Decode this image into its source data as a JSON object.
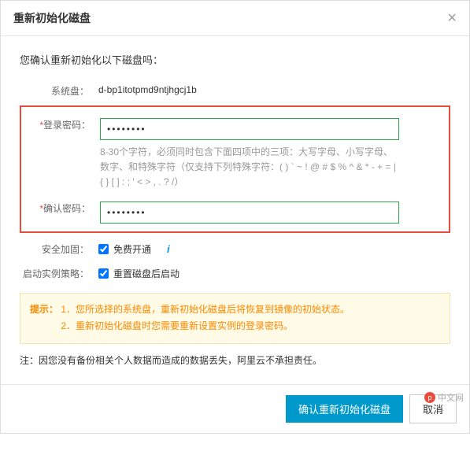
{
  "header": {
    "title": "重新初始化磁盘"
  },
  "body": {
    "confirm_question": "您确认重新初始化以下磁盘吗：",
    "system_disk_label": "系统盘：",
    "system_disk_value": "d-bp1itotpmd9ntjhgcj1b",
    "login_password_label": "登录密码：",
    "login_password_value": "••••••••",
    "password_hint": "8-30个字符，必须同时包含下面四项中的三项：大写字母、小写字母、数字、和特殊字符（仅支持下列特殊字符：( ) ` ~ ! @ # $ % ^ & * - + = | { } [ ] : ; ' < > , . ? /）",
    "confirm_password_label": "确认密码：",
    "confirm_password_value": "••••••••",
    "security_label": "安全加固：",
    "security_checkbox_label": "免费开通",
    "startup_policy_label": "启动实例策略：",
    "startup_checkbox_label": "重置磁盘后启动",
    "tip_label": "提示：",
    "tip_line1": "1．您所选择的系统盘，重新初始化磁盘后将恢复到镜像的初始状态。",
    "tip_line2": "2．重新初始化磁盘时您需要重新设置实例的登录密码。",
    "note_text": "注：因您没有备份相关个人数据而造成的数据丢失，阿里云不承担责任。"
  },
  "footer": {
    "confirm_button": "确认重新初始化磁盘",
    "cancel_button": "取消"
  },
  "watermark": {
    "text": "中文网"
  }
}
